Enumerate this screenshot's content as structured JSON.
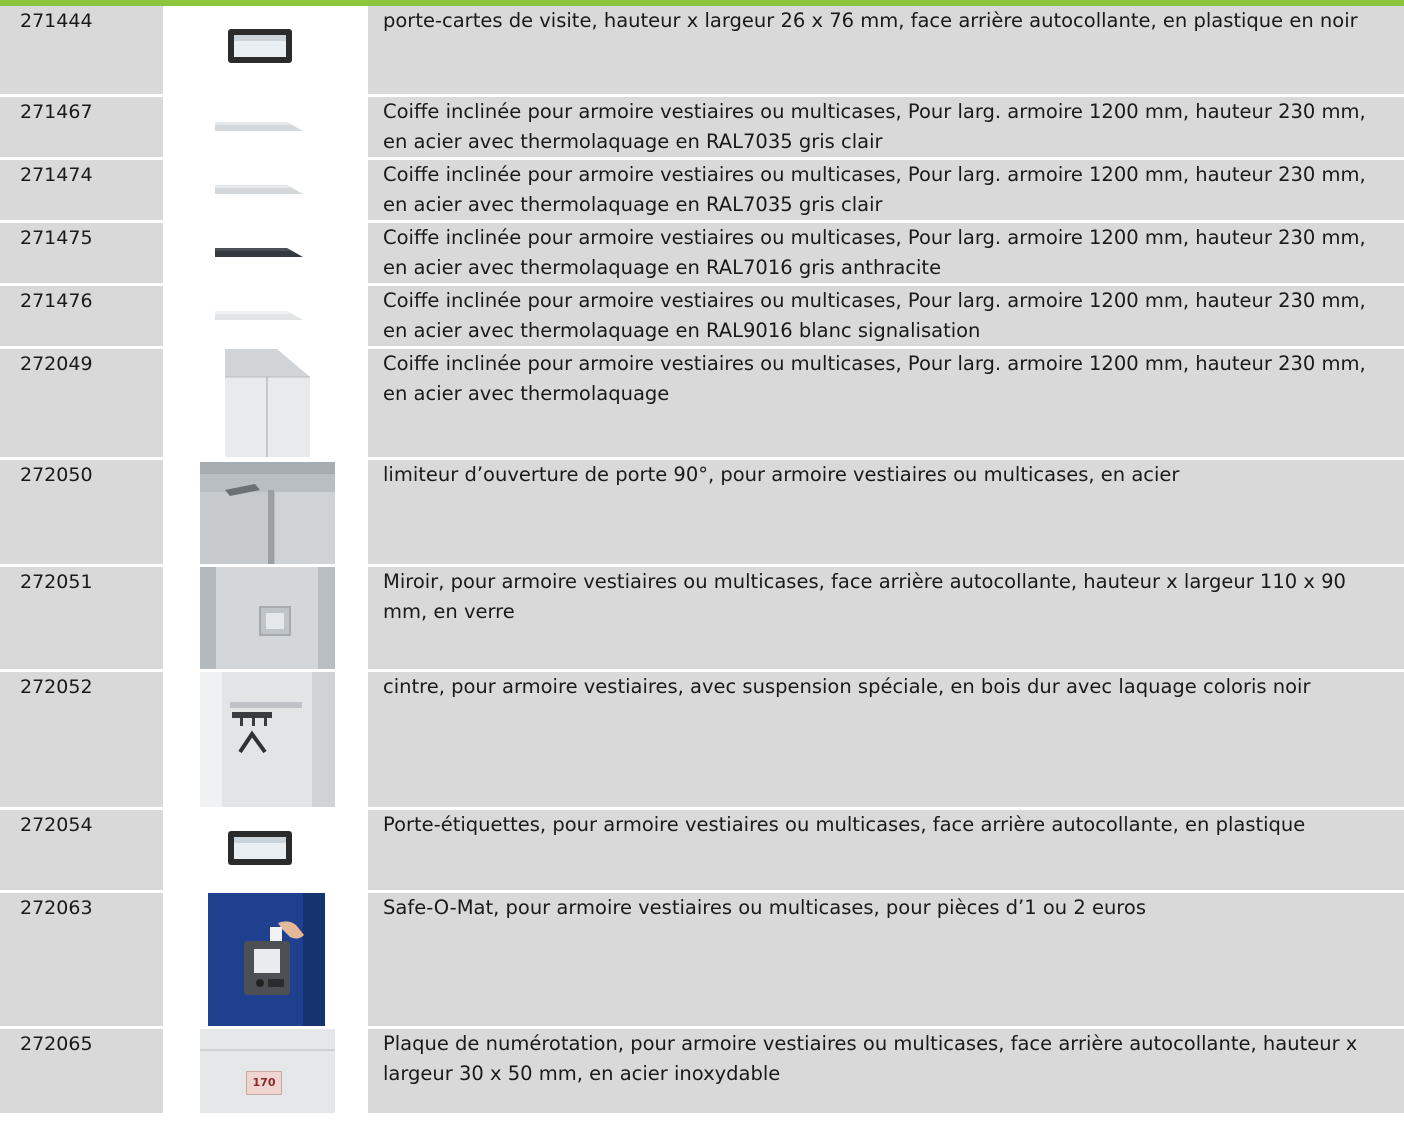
{
  "rows": [
    {
      "id": "271444",
      "desc": "porte-cartes de visite, hauteur x largeur 26 x 76 mm, face arrière autocollante, en plastique en noir",
      "image": "black-label-holder-image"
    },
    {
      "id": "271467",
      "desc": "Coiffe inclinée pour armoire vestiaires ou multicases, Pour larg. armoire 1200 mm, hauteur 230 mm, en acier avec thermolaquage en RAL7035 gris clair",
      "image": "light-grey-sloped-top-image"
    },
    {
      "id": "271474",
      "desc": "Coiffe inclinée pour armoire vestiaires ou multicases, Pour larg. armoire 1200 mm, hauteur 230 mm, en acier avec thermolaquage en RAL7035 gris clair",
      "image": "light-grey-sloped-top-image"
    },
    {
      "id": "271475",
      "desc": "Coiffe inclinée pour armoire vestiaires ou multicases, Pour larg. armoire 1200 mm, hauteur 230 mm, en acier avec thermolaquage en RAL7016 gris anthracite",
      "image": "anthracite-sloped-top-image"
    },
    {
      "id": "271476",
      "desc": "Coiffe inclinée pour armoire vestiaires ou multicases, Pour larg. armoire 1200 mm, hauteur 230 mm, en acier avec thermolaquage en RAL9016 blanc signalisation",
      "image": "white-sloped-top-image"
    },
    {
      "id": "272049",
      "desc": "Coiffe inclinée pour armoire vestiaires ou multicases, Pour larg. armoire 1200 mm, hauteur 230 mm, en acier avec thermolaquage",
      "image": "locker-sloped-top-image"
    },
    {
      "id": "272050",
      "desc": "limiteur d’ouverture de porte 90°, pour armoire vestiaires ou multicases, en acier",
      "image": "door-limiter-image"
    },
    {
      "id": "272051",
      "desc": "Miroir, pour armoire vestiaires ou multicases, face arrière autocollante, hauteur x largeur 110 x 90 mm, en verre",
      "image": "mirror-image"
    },
    {
      "id": "272052",
      "desc": "cintre, pour armoire vestiaires, avec suspension spéciale, en bois dur avec laquage coloris noir",
      "image": "hanger-image"
    },
    {
      "id": "272054",
      "desc": "Porte-étiquettes, pour armoire vestiaires ou multicases, face arrière autocollante, en plastique",
      "image": "label-holder-image"
    },
    {
      "id": "272063",
      "desc": "Safe-O-Mat, pour armoire vestiaires ou multicases, pour pièces d’1 ou 2 euros",
      "image": "safe-o-mat-image"
    },
    {
      "id": "272065",
      "desc": "Plaque de numérotation, pour armoire vestiaires ou multicases, face arrière autocollante, hauteur x largeur 30 x 50 mm, en acier inoxydable",
      "image": "number-plate-image",
      "plate_number": "170"
    }
  ]
}
